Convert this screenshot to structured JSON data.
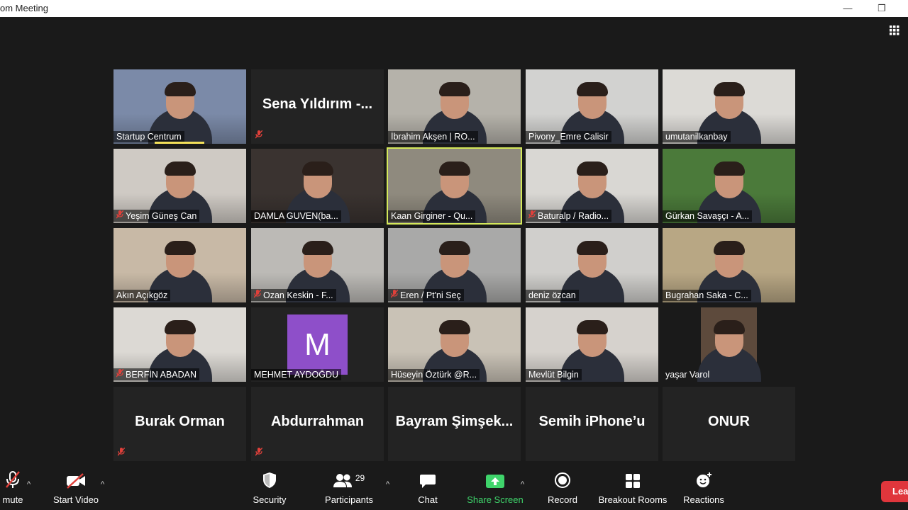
{
  "window": {
    "title": "om Meeting",
    "minimize": "—",
    "restore": "❐"
  },
  "view_button": {
    "icon": "grid-icon"
  },
  "participants_grid": [
    {
      "label": "Startup Centrum",
      "muted": false,
      "video": true,
      "speaking": true,
      "bg": "#7b8aa8"
    },
    {
      "label": "",
      "big_name": "Sena Yıldırım -...",
      "muted": true,
      "video": false
    },
    {
      "label": "İbrahim Akşen | RO...",
      "muted": false,
      "video": true,
      "bg": "#b5b2aa"
    },
    {
      "label": "Pivony_Emre Calisir",
      "muted": false,
      "video": true,
      "bg": "#d2d2d0"
    },
    {
      "label": "umutanilkanbay",
      "muted": false,
      "video": true,
      "bg": "#dcdad6"
    },
    {
      "label": "Yeşim Güneş Can",
      "muted": true,
      "video": true,
      "bg": "#cfcac4"
    },
    {
      "label": "DAMLA GUVEN(ba...",
      "muted": false,
      "video": true,
      "bg": "#3a3330"
    },
    {
      "label": "Kaan Girginer - Qu...",
      "muted": false,
      "video": true,
      "active": true,
      "bg": "#8f8a7e"
    },
    {
      "label": "Baturalp / Radio...",
      "muted": true,
      "video": true,
      "bg": "#d9d7d3"
    },
    {
      "label": "Gürkan Savaşçı - A...",
      "muted": false,
      "video": true,
      "bg": "#4b7a3a"
    },
    {
      "label": "Akın Açıkgöz",
      "muted": false,
      "video": true,
      "bg": "#c8b9a6"
    },
    {
      "label": "Ozan Keskin - F...",
      "muted": true,
      "video": true,
      "bg": "#bcbab6"
    },
    {
      "label": "Eren / Pt'ni Seç",
      "muted": true,
      "video": true,
      "bg": "#a9a9a8"
    },
    {
      "label": "deniz özcan",
      "muted": false,
      "video": true,
      "bg": "#d0cfcc"
    },
    {
      "label": "Bugrahan Saka - C...",
      "muted": false,
      "video": true,
      "bg": "#b8a784"
    },
    {
      "label": "BERFİN ABADAN",
      "muted": true,
      "video": true,
      "bg": "#dcd9d4"
    },
    {
      "label": "MEHMET AYDOĞDU",
      "muted": false,
      "video": false,
      "avatar_letter": "M"
    },
    {
      "label": "Hüseyin Öztürk @R...",
      "muted": false,
      "video": true,
      "bg": "#c9c2b6"
    },
    {
      "label": "Mevlüt Bilgin",
      "muted": false,
      "video": true,
      "bg": "#d6d2cd"
    },
    {
      "label": "yaşar Varol",
      "muted": false,
      "video": true,
      "portrait": true,
      "bg": "#5d4a3c"
    },
    {
      "label": "",
      "big_name": "Burak Orman",
      "muted": true,
      "video": false
    },
    {
      "label": "",
      "big_name": "Abdurrahman",
      "muted": true,
      "video": false
    },
    {
      "label": "",
      "big_name": "Bayram  Şimşek...",
      "muted": false,
      "video": false
    },
    {
      "label": "",
      "big_name": "Semih iPhone’u",
      "muted": false,
      "video": false
    },
    {
      "label": "",
      "big_name": "ONUR",
      "muted": false,
      "video": false
    }
  ],
  "toolbar": {
    "unmute": "mute",
    "start_video": "Start Video",
    "security": "Security",
    "participants": "Participants",
    "participants_count": "29",
    "chat": "Chat",
    "share_screen": "Share Screen",
    "record": "Record",
    "breakout_rooms": "Breakout Rooms",
    "reactions": "Reactions",
    "leave": "Leav"
  },
  "colors": {
    "share_green": "#3fd46b",
    "active_speaker": "#d4e85a",
    "leave_red": "#e0363c",
    "muted_red": "#e0403a"
  }
}
